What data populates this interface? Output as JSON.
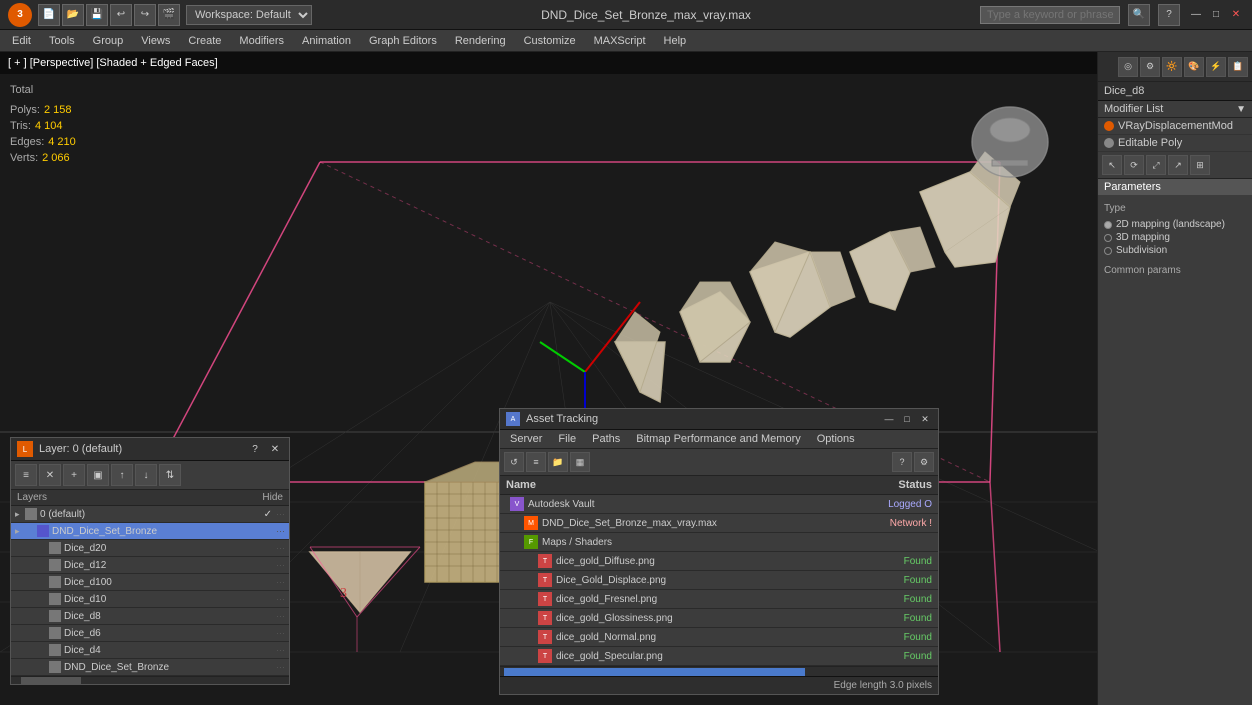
{
  "titlebar": {
    "logo": "3",
    "workspace_label": "Workspace: Default",
    "file_title": "DND_Dice_Set_Bronze_max_vray.max",
    "search_placeholder": "Type a keyword or phrase",
    "minimize": "—",
    "maximize": "□",
    "close": "✕"
  },
  "menubar": {
    "items": [
      "Edit",
      "Tools",
      "Group",
      "Views",
      "Create",
      "Modifiers",
      "Animation",
      "Graph Editors",
      "Rendering",
      "Customize",
      "MAXScript",
      "Help"
    ]
  },
  "viewport": {
    "label": "[ + ] [Perspective] [Shaded + Edged Faces]",
    "stats": {
      "polys_label": "Polys:",
      "polys_value": "2 158",
      "tris_label": "Tris:",
      "tris_value": "4 104",
      "edges_label": "Edges:",
      "edges_value": "4 210",
      "verts_label": "Verts:",
      "verts_value": "2 066"
    }
  },
  "right_panel": {
    "object_name": "Dice_d8",
    "modifier_list_label": "Modifier List",
    "modifiers": [
      {
        "name": "VRayDisplacementMod",
        "type": "orange"
      },
      {
        "name": "Editable Poly",
        "type": "default"
      }
    ],
    "parameters_title": "Parameters",
    "type_label": "Type",
    "type_options": [
      {
        "label": "2D mapping (landscape)",
        "selected": true
      },
      {
        "label": "3D mapping",
        "selected": false
      },
      {
        "label": "Subdivision",
        "selected": false
      }
    ],
    "common_params_label": "Common params"
  },
  "layer_panel": {
    "title": "Layer: 0 (default)",
    "columns": {
      "name": "Layers",
      "hide": "Hide"
    },
    "layers": [
      {
        "name": "0 (default)",
        "level": 0,
        "type": "default",
        "checked": true
      },
      {
        "name": "DND_Dice_Set_Bronze",
        "level": 1,
        "type": "blue",
        "selected": true,
        "checked": false
      },
      {
        "name": "Dice_d20",
        "level": 2,
        "type": "default",
        "checked": false
      },
      {
        "name": "Dice_d12",
        "level": 2,
        "type": "default",
        "checked": false
      },
      {
        "name": "Dice_d100",
        "level": 2,
        "type": "default",
        "checked": false
      },
      {
        "name": "Dice_d10",
        "level": 2,
        "type": "default",
        "checked": false
      },
      {
        "name": "Dice_d8",
        "level": 2,
        "type": "default",
        "checked": false
      },
      {
        "name": "Dice_d6",
        "level": 2,
        "type": "default",
        "checked": false
      },
      {
        "name": "Dice_d4",
        "level": 2,
        "type": "default",
        "checked": false
      },
      {
        "name": "DND_Dice_Set_Bronze",
        "level": 2,
        "type": "default",
        "checked": false
      }
    ]
  },
  "asset_panel": {
    "title": "Asset Tracking",
    "menu_items": [
      "Server",
      "File",
      "Paths",
      "Bitmap Performance and Memory",
      "Options"
    ],
    "columns": {
      "name": "Name",
      "status": "Status"
    },
    "assets": [
      {
        "name": "Autodesk Vault",
        "type": "vault",
        "status": "Logged O",
        "status_class": "status-logged",
        "indent": 0
      },
      {
        "name": "DND_Dice_Set_Bronze_max_vray.max",
        "type": "max",
        "status": "Network !",
        "status_class": "status-network",
        "indent": 1
      },
      {
        "name": "Maps / Shaders",
        "type": "maps",
        "status": "",
        "status_class": "",
        "indent": 1
      },
      {
        "name": "dice_gold_Diffuse.png",
        "type": "texture",
        "status": "Found",
        "status_class": "status-found",
        "indent": 2
      },
      {
        "name": "Dice_Gold_Displace.png",
        "type": "texture",
        "status": "Found",
        "status_class": "status-found",
        "indent": 2
      },
      {
        "name": "dice_gold_Fresnel.png",
        "type": "texture",
        "status": "Found",
        "status_class": "status-found",
        "indent": 2
      },
      {
        "name": "dice_gold_Glossiness.png",
        "type": "texture",
        "status": "Found",
        "status_class": "status-found",
        "indent": 2
      },
      {
        "name": "dice_gold_Normal.png",
        "type": "texture",
        "status": "Found",
        "status_class": "status-found",
        "indent": 2
      },
      {
        "name": "dice_gold_Specular.png",
        "type": "texture",
        "status": "Found",
        "status_class": "status-found",
        "indent": 2
      }
    ],
    "status_bar": {
      "left": "",
      "right": "Edge length  3.0        pixels"
    }
  }
}
